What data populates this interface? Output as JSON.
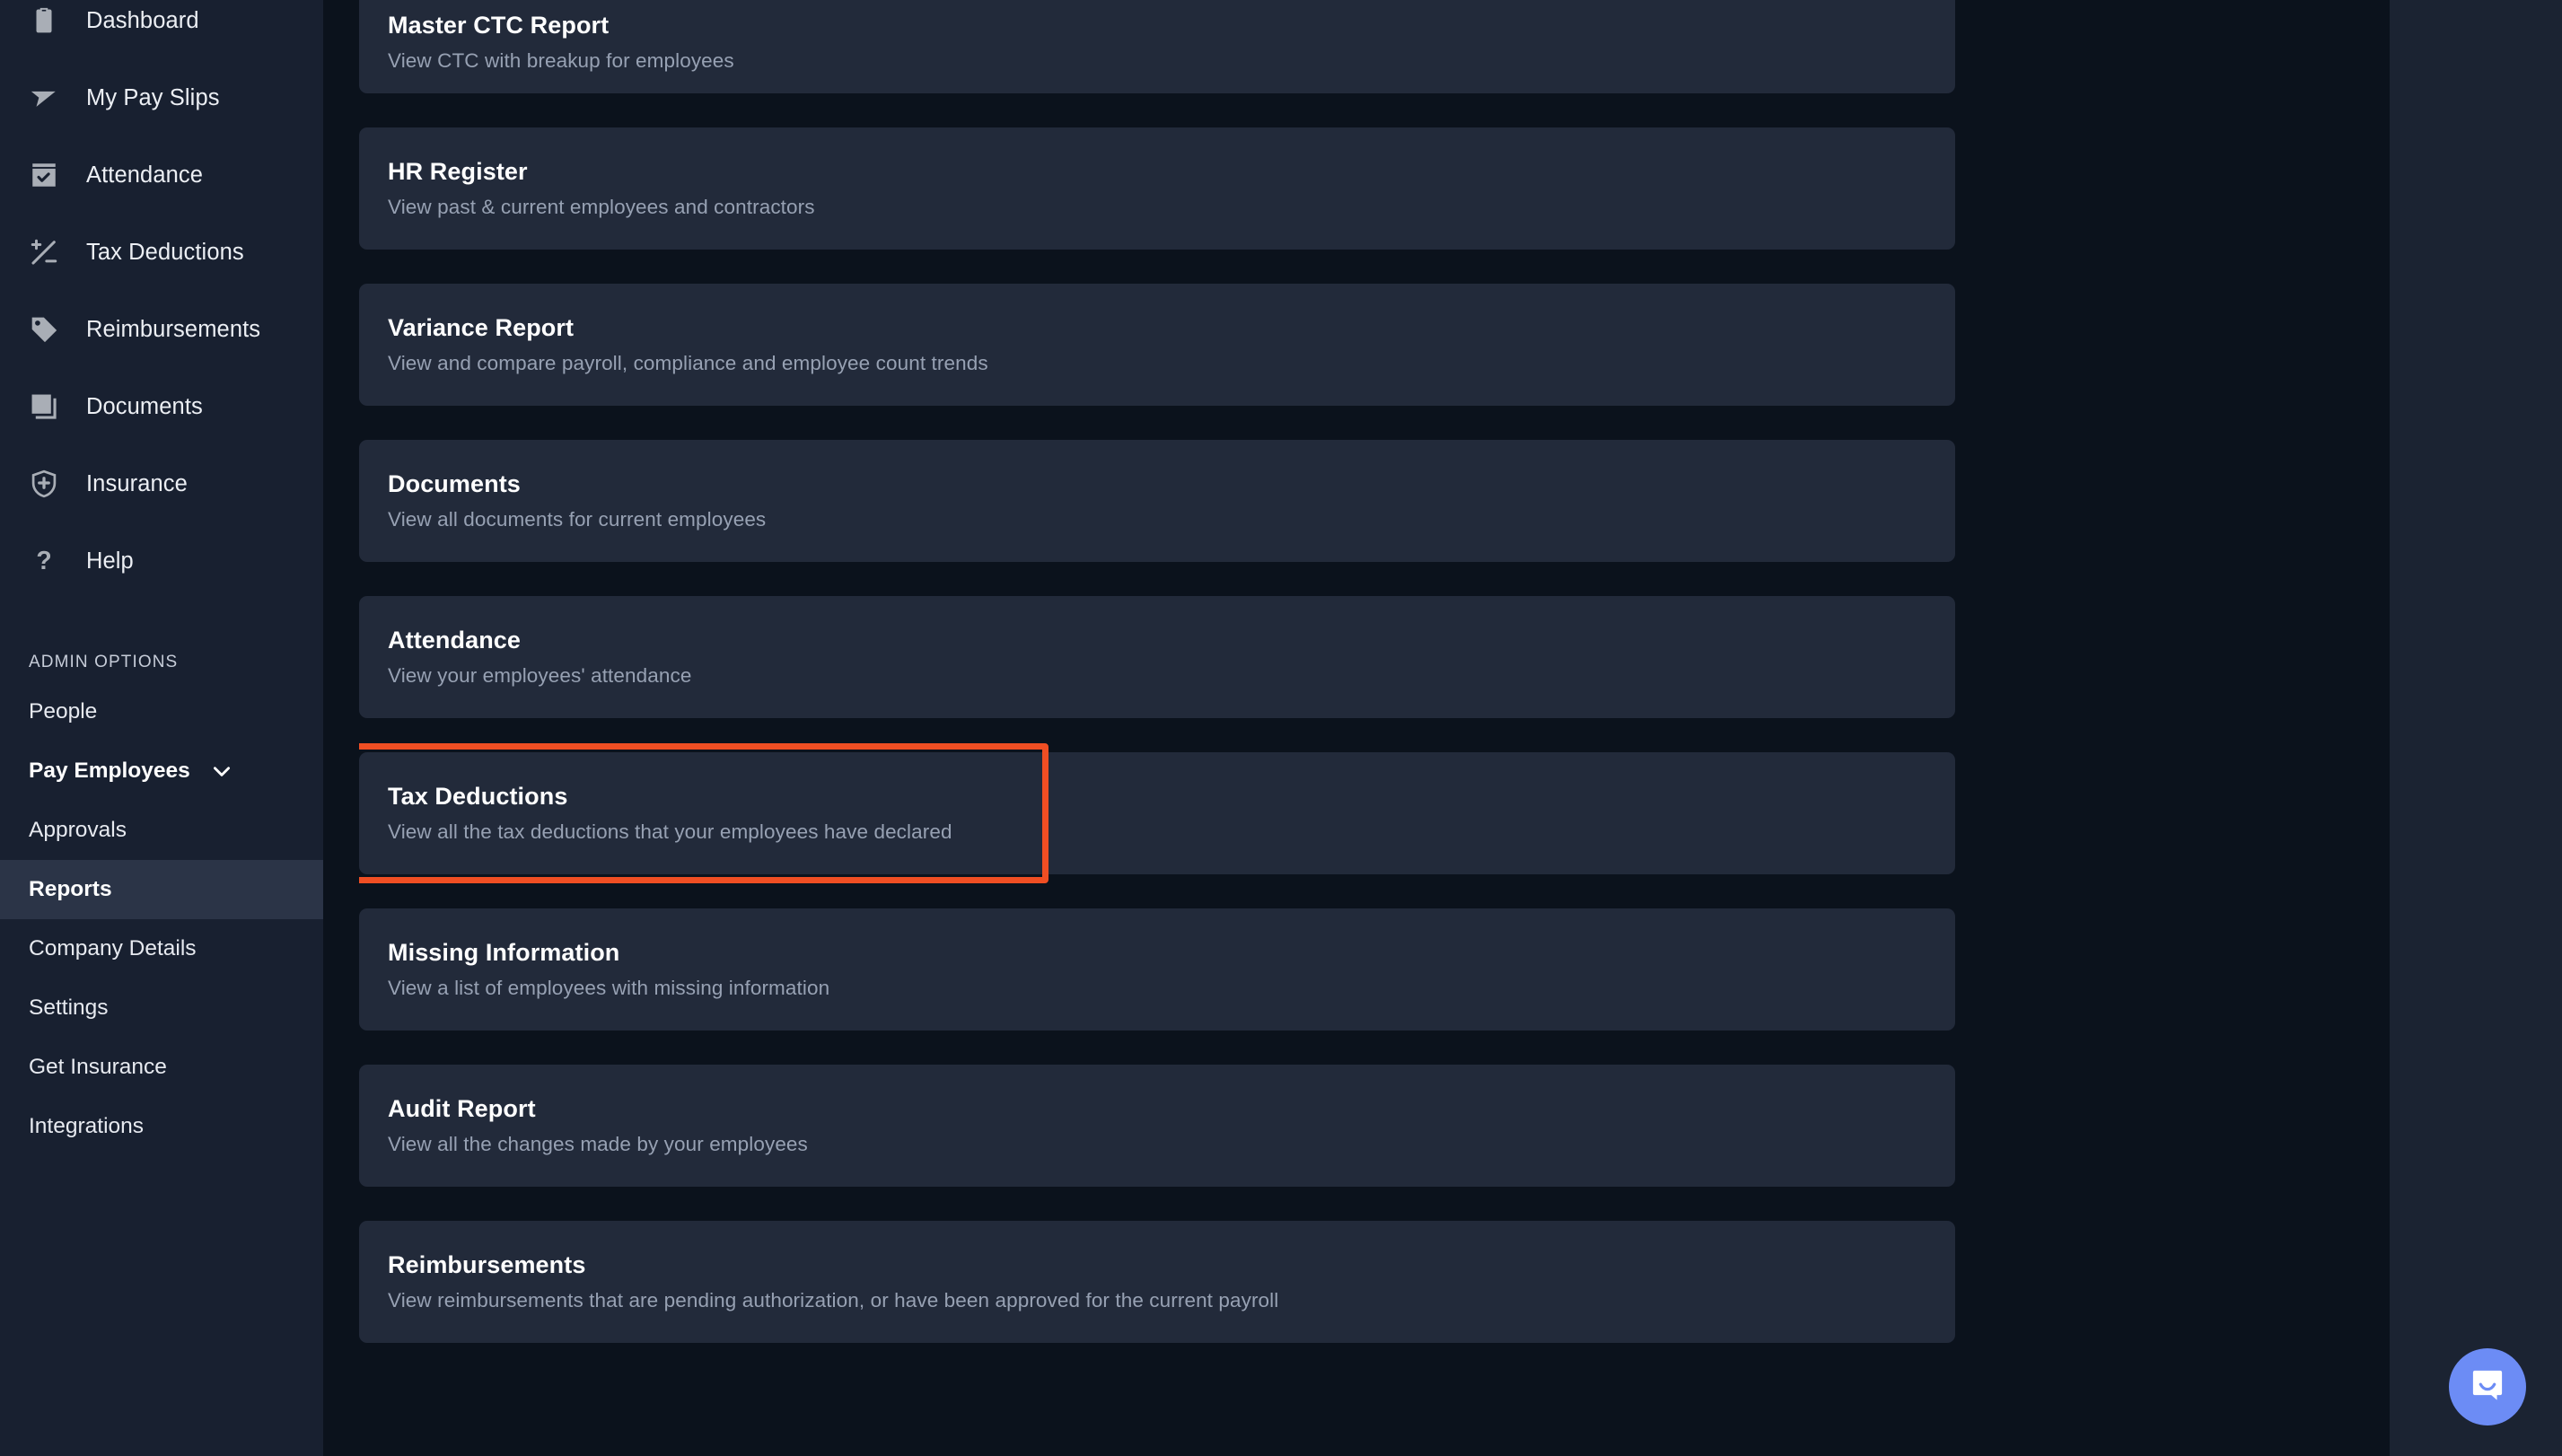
{
  "sidebar": {
    "nav": [
      {
        "label": "Dashboard",
        "icon": "clipboard-icon"
      },
      {
        "label": "My Pay Slips",
        "icon": "paper-plane-icon"
      },
      {
        "label": "Attendance",
        "icon": "calendar-check-icon"
      },
      {
        "label": "Tax Deductions",
        "icon": "plus-minus-icon"
      },
      {
        "label": "Reimbursements",
        "icon": "tag-icon"
      },
      {
        "label": "Documents",
        "icon": "documents-icon"
      },
      {
        "label": "Insurance",
        "icon": "shield-plus-icon"
      },
      {
        "label": "Help",
        "icon": "question-mark-icon"
      }
    ],
    "admin_section_label": "ADMIN OPTIONS",
    "admin": [
      {
        "label": "People",
        "state": "normal"
      },
      {
        "label": "Pay Employees",
        "state": "expanded",
        "icon": "chevron-down-icon"
      },
      {
        "label": "Approvals",
        "state": "normal"
      },
      {
        "label": "Reports",
        "state": "active"
      },
      {
        "label": "Company Details",
        "state": "normal"
      },
      {
        "label": "Settings",
        "state": "normal"
      },
      {
        "label": "Get Insurance",
        "state": "normal"
      },
      {
        "label": "Integrations",
        "state": "normal"
      }
    ]
  },
  "main": {
    "cards": [
      {
        "title": "Master CTC Report",
        "subtitle": "View CTC with breakup for employees"
      },
      {
        "title": "HR Register",
        "subtitle": "View past & current employees and contractors"
      },
      {
        "title": "Variance Report",
        "subtitle": "View and compare payroll, compliance and employee count trends"
      },
      {
        "title": "Documents",
        "subtitle": "View all documents for current employees"
      },
      {
        "title": "Attendance",
        "subtitle": "View your employees' attendance"
      },
      {
        "title": "Tax Deductions",
        "subtitle": "View all the tax deductions that your employees have declared"
      },
      {
        "title": "Missing Information",
        "subtitle": "View a list of employees with missing information"
      },
      {
        "title": "Audit Report",
        "subtitle": "View all the changes made by your employees"
      },
      {
        "title": "Reimbursements",
        "subtitle": "View reimbursements that are pending authorization, or have been approved for the current payroll"
      }
    ],
    "highlighted_card_index": 5
  },
  "widget": {
    "icon": "chat-bubble-icon"
  },
  "colors": {
    "page_background": "#0b121c",
    "sidebar_background": "#182030",
    "card_background": "#222a3a",
    "active_nav_background": "#2b3447",
    "highlight_border": "#f04e23",
    "launcher_background": "#6c8cf5",
    "right_panel_background": "#1b2332"
  }
}
